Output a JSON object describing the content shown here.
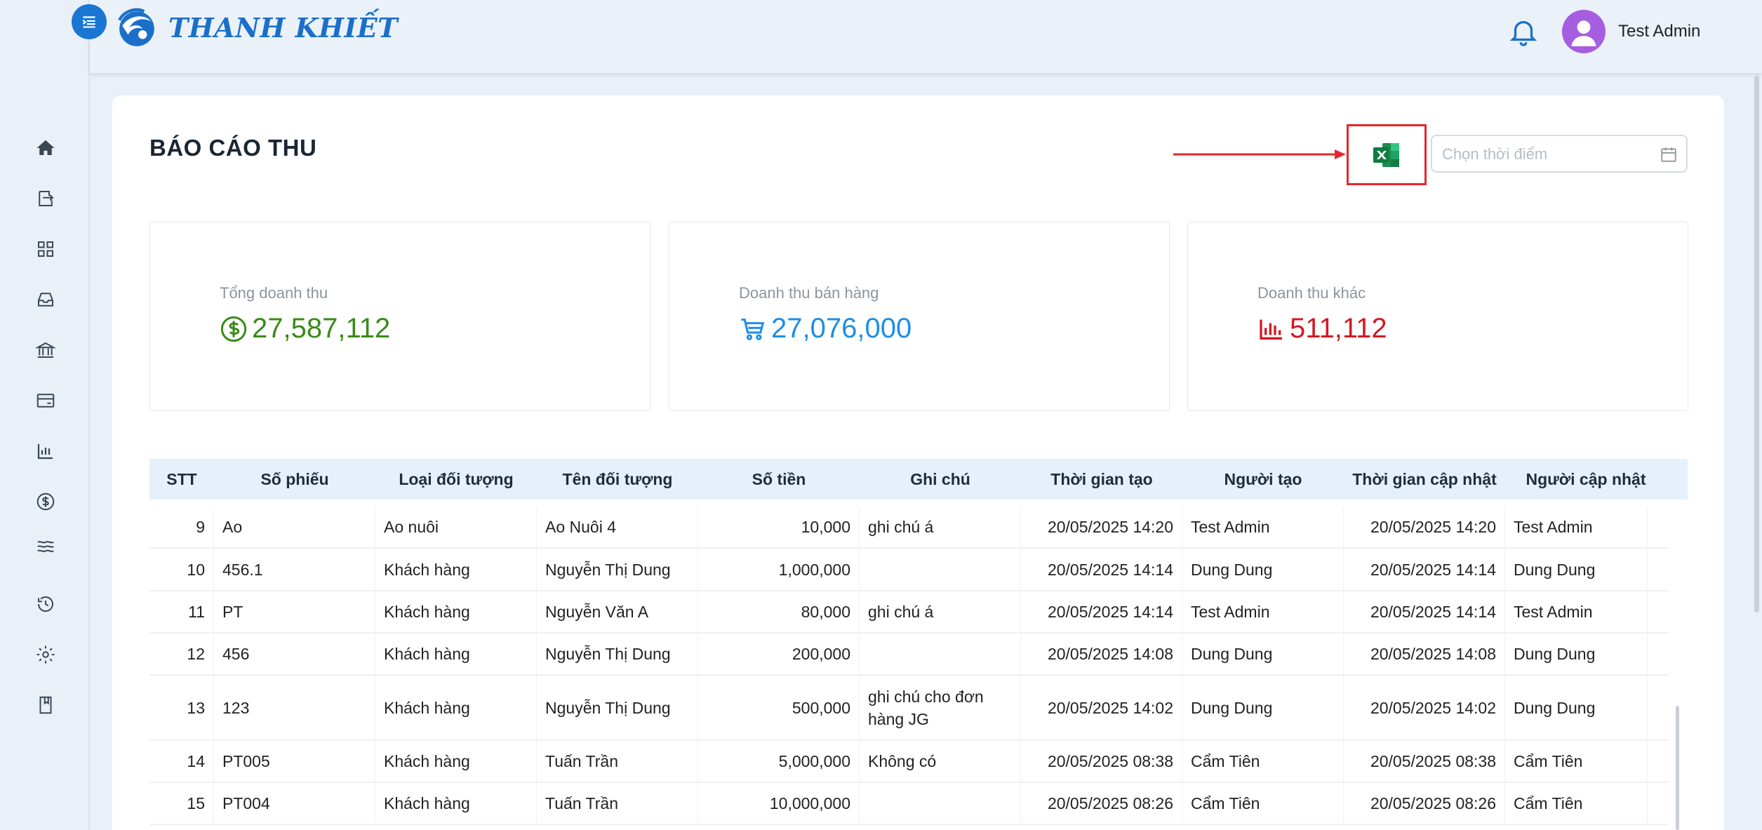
{
  "app": {
    "brand": "THANH KHIẾT",
    "user_name": "Test Admin"
  },
  "sidebar": {
    "items": [
      {
        "name": "home-icon"
      },
      {
        "name": "transfer-icon"
      },
      {
        "name": "grid-icon"
      },
      {
        "name": "inbox-icon"
      },
      {
        "name": "bank-icon"
      },
      {
        "name": "card-icon"
      },
      {
        "name": "report-icon"
      },
      {
        "name": "dollar-icon"
      },
      {
        "name": "waves-icon"
      },
      {
        "name": "history-icon"
      },
      {
        "name": "settings-icon"
      },
      {
        "name": "book-icon"
      }
    ]
  },
  "page": {
    "title": "BÁO CÁO THU",
    "date_placeholder": "Chọn thời điểm"
  },
  "stats": [
    {
      "label": "Tổng doanh thu",
      "value": "27,587,112",
      "color": "#3a8a1a",
      "icon": "dollar-circle-icon"
    },
    {
      "label": "Doanh thu bán hàng",
      "value": "27,076,000",
      "color": "#1e8ee6",
      "icon": "cart-icon"
    },
    {
      "label": "Doanh thu khác",
      "value": "511,112",
      "color": "#d11a22",
      "icon": "bar-chart-icon"
    }
  ],
  "table": {
    "headers": [
      "STT",
      "Số phiếu",
      "Loại đối tượng",
      "Tên đối tượng",
      "Số tiền",
      "Ghi chú",
      "Thời gian tạo",
      "Người tạo",
      "Thời gian cập nhật",
      "Người cập nhật"
    ],
    "rows": [
      [
        "9",
        "Ao",
        "Ao nuôi",
        "Ao Nuôi 4",
        "10,000",
        "ghi chú á",
        "20/05/2025 14:20",
        "Test Admin",
        "20/05/2025 14:20",
        "Test Admin"
      ],
      [
        "10",
        "456.1",
        "Khách hàng",
        "Nguyễn Thị Dung",
        "1,000,000",
        "",
        "20/05/2025 14:14",
        "Dung Dung",
        "20/05/2025 14:14",
        "Dung Dung"
      ],
      [
        "11",
        "PT",
        "Khách hàng",
        "Nguyễn Văn A",
        "80,000",
        "ghi chú á",
        "20/05/2025 14:14",
        "Test Admin",
        "20/05/2025 14:14",
        "Test Admin"
      ],
      [
        "12",
        "456",
        "Khách hàng",
        "Nguyễn Thị Dung",
        "200,000",
        "",
        "20/05/2025 14:08",
        "Dung Dung",
        "20/05/2025 14:08",
        "Dung Dung"
      ],
      [
        "13",
        "123",
        "Khách hàng",
        "Nguyễn Thị Dung",
        "500,000",
        "ghi chú cho đơn hàng JG",
        "20/05/2025 14:02",
        "Dung Dung",
        "20/05/2025 14:02",
        "Dung Dung"
      ],
      [
        "14",
        "PT005",
        "Khách hàng",
        "Tuấn Trần",
        "5,000,000",
        "Không có",
        "20/05/2025 08:38",
        "Cẩm Tiên",
        "20/05/2025 08:38",
        "Cẩm Tiên"
      ],
      [
        "15",
        "PT004",
        "Khách hàng",
        "Tuấn Trần",
        "10,000,000",
        "",
        "20/05/2025 08:26",
        "Cẩm Tiên",
        "20/05/2025 08:26",
        "Cẩm Tiên"
      ]
    ]
  }
}
